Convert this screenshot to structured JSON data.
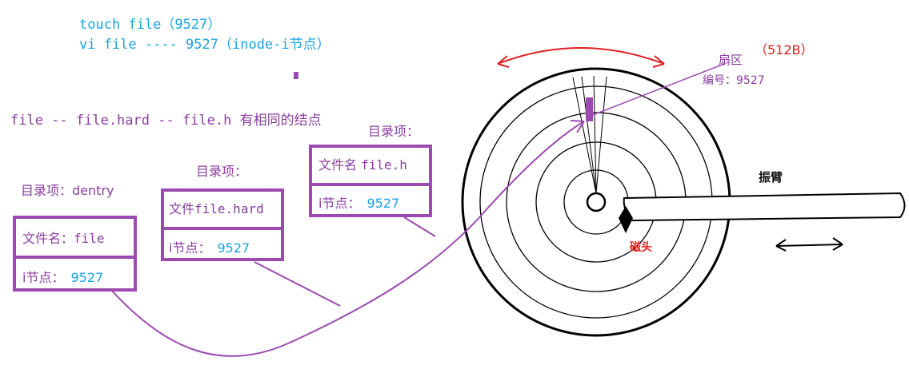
{
  "commands": {
    "touch": "touch file（9527）",
    "vi": "vi file ---- 9527（inode-i节点）"
  },
  "note": "file -- file.hard -- file.h 有相同的结点",
  "dentry_title": "目录项：dentry",
  "entries": [
    {
      "title": "",
      "name_label": "文件名：",
      "name": "file",
      "inode_label": "i节点：",
      "inode": "9527"
    },
    {
      "title": "目录项：",
      "name_label": "文件",
      "name": "file.hard",
      "inode_label": "i节点：",
      "inode": "9527"
    },
    {
      "title": "目录项：",
      "name_label": "文件名",
      "name": "file.h",
      "inode_label": "i节点：",
      "inode": "9527"
    }
  ],
  "disk": {
    "sector_label": "扇区",
    "sector_size": "（512B）",
    "sector_number": "编号：9527",
    "arm_label": "振臂",
    "head_label": "磁头"
  },
  "colors": {
    "purple": "#9b4bb0",
    "blue": "#1aa3e0",
    "red": "#e02020"
  }
}
